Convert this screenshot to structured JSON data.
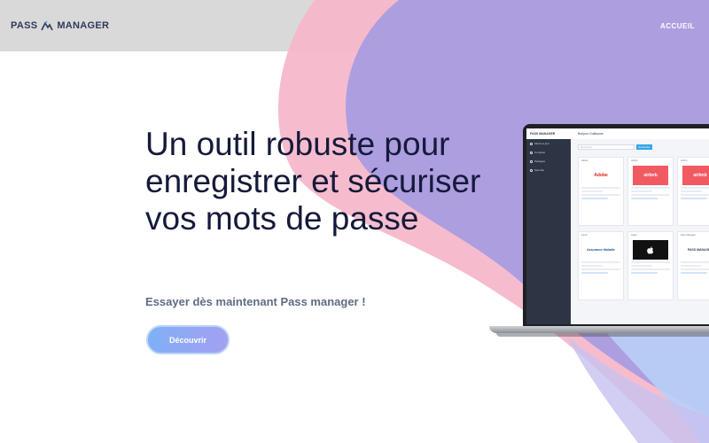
{
  "header": {
    "logo_left": "PASS",
    "logo_right": "MANAGER",
    "nav_home": "ACCUEIL"
  },
  "hero": {
    "title_lines": [
      "Un outil robuste pour",
      "enregistrer et sécuriser",
      "vos mots de passe"
    ],
    "subtitle": "Essayer dès maintenant Pass manager !",
    "cta_label": "Découvrir"
  },
  "colors": {
    "header_bg": "#d9d9d9",
    "pink_shape": "#f6b8cb",
    "purple_shape": "#a99ce0",
    "blue_shape": "#b9cff7",
    "hero_title": "#151a3a",
    "cta_gradient_start": "#7fb0f6",
    "cta_gradient_end": "#a3a0f1"
  },
  "mockup": {
    "app_logo": "PASS MANAGER",
    "greeting": "Bonjour Guillaume",
    "sidebar_items": [
      "Mettre à jour",
      "Comptes",
      "Partages",
      "Sécurité"
    ],
    "search_placeholder": "Rechercher...",
    "search_button": "Rechercher",
    "cards": [
      {
        "title": "Adobe",
        "brand": "Adobe",
        "brand_color": "#e2231a",
        "logo_bg": "#ffffff"
      },
      {
        "title": "Airbnb",
        "brand": "airbnb",
        "brand_color": "#ffffff",
        "logo_bg": "#f25a62"
      },
      {
        "title": "Airbnb",
        "brand": "airbnb",
        "brand_color": "#ffffff",
        "logo_bg": "#f25a62"
      },
      {
        "title": "Ameli",
        "brand": "Assurance Maladie",
        "brand_color": "#1f4e8c",
        "logo_bg": "#ffffff"
      },
      {
        "title": "Apple",
        "brand": "",
        "brand_color": "#ffffff",
        "logo_bg": "#111111"
      },
      {
        "title": "Pass Manager",
        "brand": "PASS MANAGER",
        "brand_color": "#2c3a5a",
        "logo_bg": "#ffffff"
      }
    ]
  }
}
